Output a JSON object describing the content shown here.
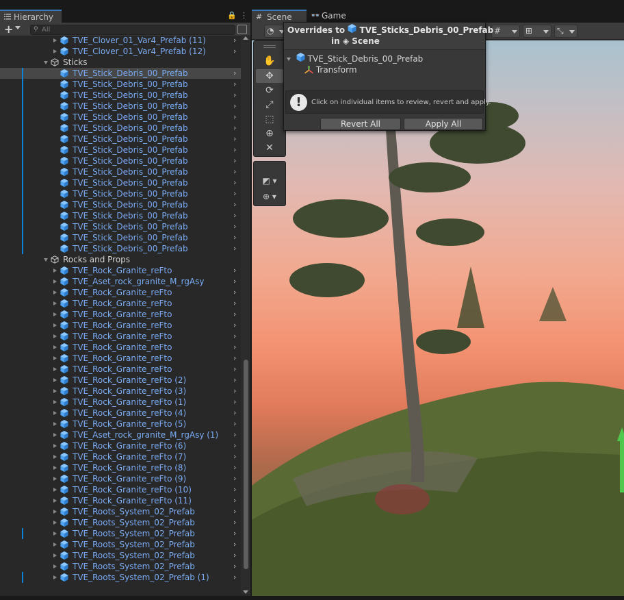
{
  "colors": {
    "prefab_text": "#7bacf4",
    "override_bar": "#0a84d8",
    "selection": "#474747",
    "panel_bg": "#282828",
    "tab_accent": "#3a79bb"
  },
  "hierarchy": {
    "tab_label": "Hierarchy",
    "lock_glyph": "🔒",
    "menu_glyph": "⋮",
    "search_placeholder": "All",
    "rows": [
      {
        "label": "TVE_Clover_01_Var4_Prefab (11)",
        "type": "prefab",
        "indent": 1,
        "foldout": "closed",
        "chevron": true,
        "override": false
      },
      {
        "label": "TVE_Clover_01_Var4_Prefab (12)",
        "type": "prefab",
        "indent": 1,
        "foldout": "closed",
        "chevron": true,
        "override": false
      },
      {
        "label": "Sticks",
        "type": "object",
        "indent": 0,
        "foldout": "open",
        "chevron": false,
        "override": false
      },
      {
        "label": "TVE_Stick_Debris_00_Prefab",
        "type": "prefab",
        "indent": 1,
        "foldout": "none",
        "chevron": true,
        "override": true,
        "selected": true
      },
      {
        "label": "TVE_Stick_Debris_00_Prefab",
        "type": "prefab",
        "indent": 1,
        "foldout": "none",
        "chevron": true,
        "override": true
      },
      {
        "label": "TVE_Stick_Debris_00_Prefab",
        "type": "prefab",
        "indent": 1,
        "foldout": "none",
        "chevron": true,
        "override": true
      },
      {
        "label": "TVE_Stick_Debris_00_Prefab",
        "type": "prefab",
        "indent": 1,
        "foldout": "none",
        "chevron": true,
        "override": true
      },
      {
        "label": "TVE_Stick_Debris_00_Prefab",
        "type": "prefab",
        "indent": 1,
        "foldout": "none",
        "chevron": true,
        "override": true
      },
      {
        "label": "TVE_Stick_Debris_00_Prefab",
        "type": "prefab",
        "indent": 1,
        "foldout": "none",
        "chevron": true,
        "override": true
      },
      {
        "label": "TVE_Stick_Debris_00_Prefab",
        "type": "prefab",
        "indent": 1,
        "foldout": "none",
        "chevron": true,
        "override": true
      },
      {
        "label": "TVE_Stick_Debris_00_Prefab",
        "type": "prefab",
        "indent": 1,
        "foldout": "none",
        "chevron": true,
        "override": true
      },
      {
        "label": "TVE_Stick_Debris_00_Prefab",
        "type": "prefab",
        "indent": 1,
        "foldout": "none",
        "chevron": true,
        "override": true
      },
      {
        "label": "TVE_Stick_Debris_00_Prefab",
        "type": "prefab",
        "indent": 1,
        "foldout": "none",
        "chevron": true,
        "override": true
      },
      {
        "label": "TVE_Stick_Debris_00_Prefab",
        "type": "prefab",
        "indent": 1,
        "foldout": "none",
        "chevron": true,
        "override": true
      },
      {
        "label": "TVE_Stick_Debris_00_Prefab",
        "type": "prefab",
        "indent": 1,
        "foldout": "none",
        "chevron": true,
        "override": true
      },
      {
        "label": "TVE_Stick_Debris_00_Prefab",
        "type": "prefab",
        "indent": 1,
        "foldout": "none",
        "chevron": true,
        "override": true
      },
      {
        "label": "TVE_Stick_Debris_00_Prefab",
        "type": "prefab",
        "indent": 1,
        "foldout": "none",
        "chevron": true,
        "override": true
      },
      {
        "label": "TVE_Stick_Debris_00_Prefab",
        "type": "prefab",
        "indent": 1,
        "foldout": "none",
        "chevron": true,
        "override": true
      },
      {
        "label": "TVE_Stick_Debris_00_Prefab",
        "type": "prefab",
        "indent": 1,
        "foldout": "none",
        "chevron": true,
        "override": true
      },
      {
        "label": "TVE_Stick_Debris_00_Prefab",
        "type": "prefab",
        "indent": 1,
        "foldout": "none",
        "chevron": true,
        "override": true
      },
      {
        "label": "Rocks and Props",
        "type": "object",
        "indent": 0,
        "foldout": "open",
        "chevron": false,
        "override": false
      },
      {
        "label": "TVE_Rock_Granite_reFto",
        "type": "prefab",
        "indent": 1,
        "foldout": "closed",
        "chevron": true,
        "override": false
      },
      {
        "label": "TVE_Aset_rock_granite_M_rgAsy",
        "type": "prefab",
        "indent": 1,
        "foldout": "closed",
        "chevron": true,
        "override": false
      },
      {
        "label": "TVE_Rock_Granite_reFto",
        "type": "prefab",
        "indent": 1,
        "foldout": "closed",
        "chevron": true,
        "override": false
      },
      {
        "label": "TVE_Rock_Granite_reFto",
        "type": "prefab",
        "indent": 1,
        "foldout": "closed",
        "chevron": true,
        "override": false
      },
      {
        "label": "TVE_Rock_Granite_reFto",
        "type": "prefab",
        "indent": 1,
        "foldout": "closed",
        "chevron": true,
        "override": false
      },
      {
        "label": "TVE_Rock_Granite_reFto",
        "type": "prefab",
        "indent": 1,
        "foldout": "closed",
        "chevron": true,
        "override": false
      },
      {
        "label": "TVE_Rock_Granite_reFto",
        "type": "prefab",
        "indent": 1,
        "foldout": "closed",
        "chevron": true,
        "override": false
      },
      {
        "label": "TVE_Rock_Granite_reFto",
        "type": "prefab",
        "indent": 1,
        "foldout": "closed",
        "chevron": true,
        "override": false
      },
      {
        "label": "TVE_Rock_Granite_reFto",
        "type": "prefab",
        "indent": 1,
        "foldout": "closed",
        "chevron": true,
        "override": false
      },
      {
        "label": "TVE_Rock_Granite_reFto",
        "type": "prefab",
        "indent": 1,
        "foldout": "closed",
        "chevron": true,
        "override": false
      },
      {
        "label": "TVE_Rock_Granite_reFto (2)",
        "type": "prefab",
        "indent": 1,
        "foldout": "closed",
        "chevron": true,
        "override": false
      },
      {
        "label": "TVE_Rock_Granite_reFto (3)",
        "type": "prefab",
        "indent": 1,
        "foldout": "closed",
        "chevron": true,
        "override": false
      },
      {
        "label": "TVE_Rock_Granite_reFto (1)",
        "type": "prefab",
        "indent": 1,
        "foldout": "closed",
        "chevron": true,
        "override": false
      },
      {
        "label": "TVE_Rock_Granite_reFto (4)",
        "type": "prefab",
        "indent": 1,
        "foldout": "closed",
        "chevron": true,
        "override": false
      },
      {
        "label": "TVE_Rock_Granite_reFto (5)",
        "type": "prefab",
        "indent": 1,
        "foldout": "closed",
        "chevron": true,
        "override": false
      },
      {
        "label": "TVE_Aset_rock_granite_M_rgAsy (1)",
        "type": "prefab",
        "indent": 1,
        "foldout": "closed",
        "chevron": true,
        "override": false
      },
      {
        "label": "TVE_Rock_Granite_reFto (6)",
        "type": "prefab",
        "indent": 1,
        "foldout": "closed",
        "chevron": true,
        "override": false
      },
      {
        "label": "TVE_Rock_Granite_reFto (7)",
        "type": "prefab",
        "indent": 1,
        "foldout": "closed",
        "chevron": true,
        "override": false
      },
      {
        "label": "TVE_Rock_Granite_reFto (8)",
        "type": "prefab",
        "indent": 1,
        "foldout": "closed",
        "chevron": true,
        "override": false
      },
      {
        "label": "TVE_Rock_Granite_reFto (9)",
        "type": "prefab",
        "indent": 1,
        "foldout": "closed",
        "chevron": true,
        "override": false
      },
      {
        "label": "TVE_Rock_Granite_reFto (10)",
        "type": "prefab",
        "indent": 1,
        "foldout": "closed",
        "chevron": true,
        "override": false
      },
      {
        "label": "TVE_Rock_Granite_reFto (11)",
        "type": "prefab",
        "indent": 1,
        "foldout": "closed",
        "chevron": true,
        "override": false
      },
      {
        "label": "TVE_Roots_System_02_Prefab",
        "type": "prefab",
        "indent": 1,
        "foldout": "closed",
        "chevron": true,
        "override": false
      },
      {
        "label": "TVE_Roots_System_02_Prefab",
        "type": "prefab",
        "indent": 1,
        "foldout": "closed",
        "chevron": true,
        "override": false
      },
      {
        "label": "TVE_Roots_System_02_Prefab",
        "type": "prefab",
        "indent": 1,
        "foldout": "closed",
        "chevron": true,
        "override": true
      },
      {
        "label": "TVE_Roots_System_02_Prefab",
        "type": "prefab",
        "indent": 1,
        "foldout": "closed",
        "chevron": true,
        "override": false
      },
      {
        "label": "TVE_Roots_System_02_Prefab",
        "type": "prefab",
        "indent": 1,
        "foldout": "closed",
        "chevron": true,
        "override": false
      },
      {
        "label": "TVE_Roots_System_02_Prefab",
        "type": "prefab",
        "indent": 1,
        "foldout": "closed",
        "chevron": true,
        "override": false
      },
      {
        "label": "TVE_Roots_System_02_Prefab (1)",
        "type": "prefab",
        "indent": 1,
        "foldout": "closed",
        "chevron": true,
        "override": true
      }
    ]
  },
  "scene": {
    "tabs": [
      {
        "label": "Scene",
        "icon": "#",
        "active": true
      },
      {
        "label": "Game",
        "icon": "👓",
        "active": false
      }
    ],
    "tools": [
      "hand-icon",
      "move-icon",
      "rotate-icon",
      "scale-icon",
      "rect-icon",
      "transform-icon",
      "custom-tool-icon"
    ],
    "tool_glyphs": [
      "✋",
      "✥",
      "⟳",
      "⤢",
      "⬚",
      "⊕",
      "✕"
    ],
    "overrides_popup": {
      "title_prefix": "Overrides to",
      "prefab_name": "TVE_Sticks_Debris_00_Prefab",
      "in_prefix": "in",
      "scene_name": "Scene",
      "object_name": "TVE_Stick_Debris_00_Prefab",
      "component_name": "Transform",
      "info_text": "Click on individual items to review, revert and apply.",
      "revert_all_label": "Revert All",
      "apply_all_label": "Apply All"
    }
  }
}
